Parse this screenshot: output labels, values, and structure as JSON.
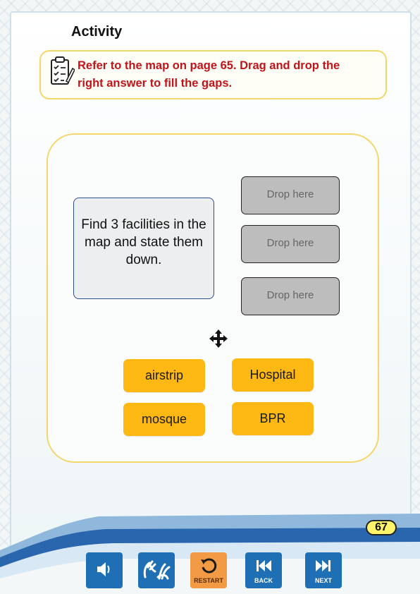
{
  "activity": {
    "title": "Activity",
    "instruction_line1": "Refer to the map on page 65. Drag and drop the",
    "instruction_line2": "right answer to fill the gaps.",
    "instruction_icon": "checklist-clipboard-icon"
  },
  "question": {
    "lines": [
      "Find 3 facilities in the",
      "map and state them",
      "down."
    ]
  },
  "drop_zones": [
    "Drop here",
    "Drop here",
    "Drop here"
  ],
  "options": [
    "airstrip",
    "Hospital",
    "mosque",
    "BPR"
  ],
  "drag_icon": "move-arrows-icon",
  "page_number": "67",
  "toolbar": {
    "buttons": [
      {
        "name": "audio",
        "icon": "speaker-icon",
        "label": ""
      },
      {
        "name": "sign-language",
        "icon": "sign-language-icon",
        "label": ""
      },
      {
        "name": "restart",
        "icon": "restart-icon",
        "label": "RESTART"
      },
      {
        "name": "back",
        "icon": "skip-back-icon",
        "label": "BACK"
      },
      {
        "name": "next",
        "icon": "skip-next-icon",
        "label": "NEXT"
      }
    ]
  },
  "colors": {
    "instruction_text": "#c0141a",
    "option_fill": "#fdb813",
    "drop_fill": "#bdbdbd",
    "toolbar_blue": "#1e6fb4",
    "restart_orange": "#f39a44",
    "panel_border": "#f4d66a"
  }
}
